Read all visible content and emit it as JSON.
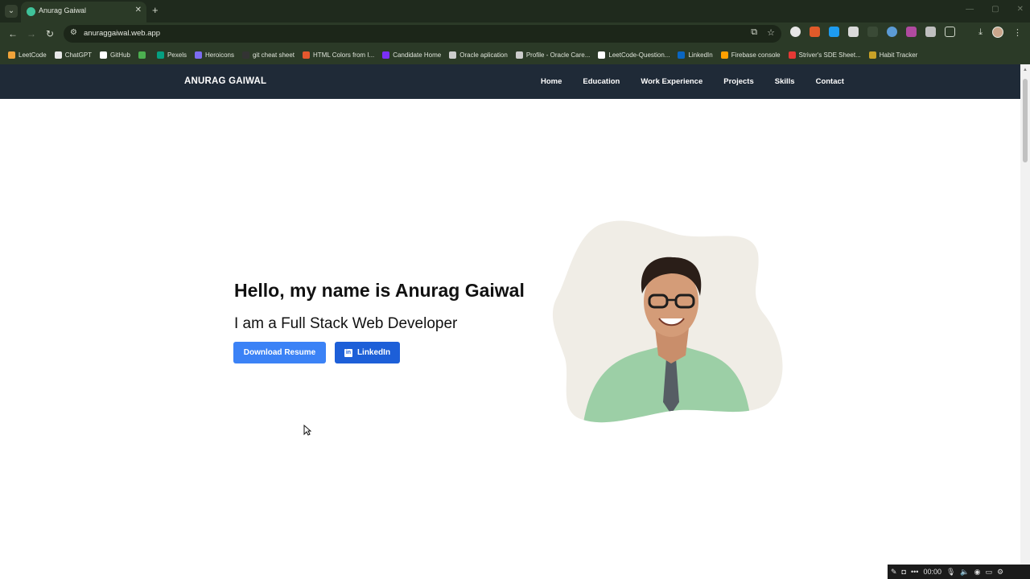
{
  "browser": {
    "tab_title": "Anurag Gaiwal",
    "url": "anuraggaiwal.web.app",
    "bookmarks": [
      {
        "label": "LeetCode",
        "color": "#f0a33a"
      },
      {
        "label": "ChatGPT",
        "color": "#e8e8e8"
      },
      {
        "label": "GitHub",
        "color": "#ffffff"
      },
      {
        "label": "",
        "color": "#4caf50"
      },
      {
        "label": "Pexels",
        "color": "#05a081"
      },
      {
        "label": "Heroicons",
        "color": "#7c6cf0"
      },
      {
        "label": "git cheat sheet",
        "color": "#333333"
      },
      {
        "label": "HTML Colors from I...",
        "color": "#e4572e"
      },
      {
        "label": "Candidate Home",
        "color": "#7b2ff7"
      },
      {
        "label": "Oracle aplication",
        "color": "#cccccc"
      },
      {
        "label": "Profile - Oracle Care...",
        "color": "#cccccc"
      },
      {
        "label": "LeetCode-Question...",
        "color": "#ffffff"
      },
      {
        "label": "LinkedIn",
        "color": "#0a66c2"
      },
      {
        "label": "Firebase console",
        "color": "#ffa000"
      },
      {
        "label": "Striver's SDE Sheet...",
        "color": "#e53935"
      },
      {
        "label": "Habit Tracker",
        "color": "#c9a227"
      }
    ]
  },
  "site": {
    "brand": "ANURAG GAIWAL",
    "nav": [
      "Home",
      "Education",
      "Work Experience",
      "Projects",
      "Skills",
      "Contact"
    ],
    "hero": {
      "title": "Hello, my name is Anurag Gaiwal",
      "subtitle": "I am a Full Stack Web Developer",
      "resume_button": "Download Resume",
      "linkedin_button": "LinkedIn"
    }
  },
  "capture_bar": {
    "time": "00:00"
  },
  "colors": {
    "nav_bg": "#1f2a37",
    "primary": "#3b82f6",
    "linkedin": "#1d5fd8",
    "browser_frame": "#2b3a27"
  }
}
